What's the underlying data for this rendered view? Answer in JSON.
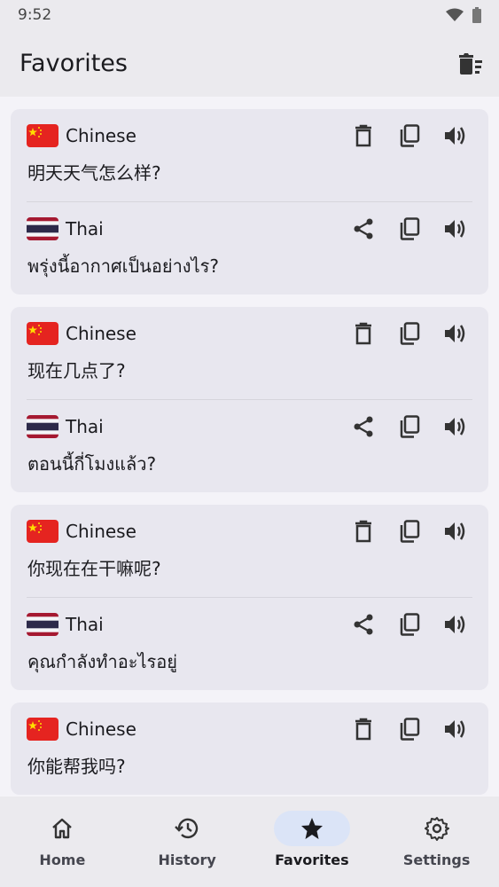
{
  "status_bar": {
    "time": "9:52"
  },
  "app_bar": {
    "title": "Favorites"
  },
  "favorites": [
    {
      "source": {
        "language": "Chinese",
        "text": "明天天气怎么样?"
      },
      "target": {
        "language": "Thai",
        "text": "พรุ่งนี้อากาศเป็นอย่างไร?"
      }
    },
    {
      "source": {
        "language": "Chinese",
        "text": "现在几点了?"
      },
      "target": {
        "language": "Thai",
        "text": "ตอนนี้กี่โมงแล้ว?"
      }
    },
    {
      "source": {
        "language": "Chinese",
        "text": "你现在在干嘛呢?"
      },
      "target": {
        "language": "Thai",
        "text": "คุณกำลังทำอะไรอยู่"
      }
    },
    {
      "source": {
        "language": "Chinese",
        "text": "你能帮我吗?"
      },
      "target": {
        "language": "Thai",
        "text": ""
      }
    }
  ],
  "nav": {
    "items": [
      {
        "label": "Home",
        "icon": "home-icon"
      },
      {
        "label": "History",
        "icon": "history-icon"
      },
      {
        "label": "Favorites",
        "icon": "star-icon",
        "active": true
      },
      {
        "label": "Settings",
        "icon": "gear-icon"
      }
    ]
  },
  "colors": {
    "accent_pill": "#dbe4f7",
    "surface": "#e8e7ef",
    "background": "#f4f3f8"
  }
}
